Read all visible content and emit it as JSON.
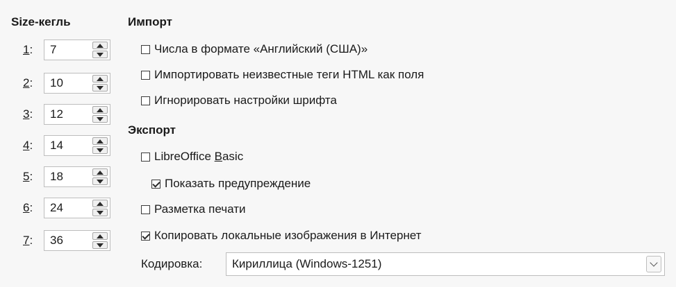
{
  "sizes": {
    "title": "Size-кегль",
    "rows": [
      {
        "num": "1",
        "suffix": ":",
        "value": "7"
      },
      {
        "num": "2",
        "suffix": ":",
        "value": "10"
      },
      {
        "num": "3",
        "suffix": ":",
        "value": "12"
      },
      {
        "num": "4",
        "suffix": ":",
        "value": "14"
      },
      {
        "num": "5",
        "suffix": ":",
        "value": "18"
      },
      {
        "num": "6",
        "suffix": ":",
        "value": "24"
      },
      {
        "num": "7",
        "suffix": ":",
        "value": "36"
      }
    ]
  },
  "import": {
    "title": "Импорт",
    "options": [
      {
        "label": "Числа в формате «Английский (США)»",
        "checked": false
      },
      {
        "label": "Импортировать неизвестные теги HTML как поля",
        "checked": false
      },
      {
        "label": "Игнорировать настройки шрифта",
        "checked": false
      }
    ]
  },
  "export": {
    "title": "Экспорт",
    "basic_label_pre": "LibreOffice ",
    "basic_label_mnemonic": "B",
    "basic_label_post": "asic",
    "basic_checked": false,
    "show_warning_label": "Показать предупреждение",
    "show_warning_checked": true,
    "print_layout_label": "Разметка печати",
    "print_layout_checked": false,
    "copy_images_label": "Копировать локальные изображения в Интернет",
    "copy_images_checked": true,
    "encoding_label": "Кодировка:",
    "encoding_value": "Кириллица (Windows-1251)"
  },
  "colors": {
    "background": "#f7f7f7",
    "border": "#bdbdbd"
  }
}
